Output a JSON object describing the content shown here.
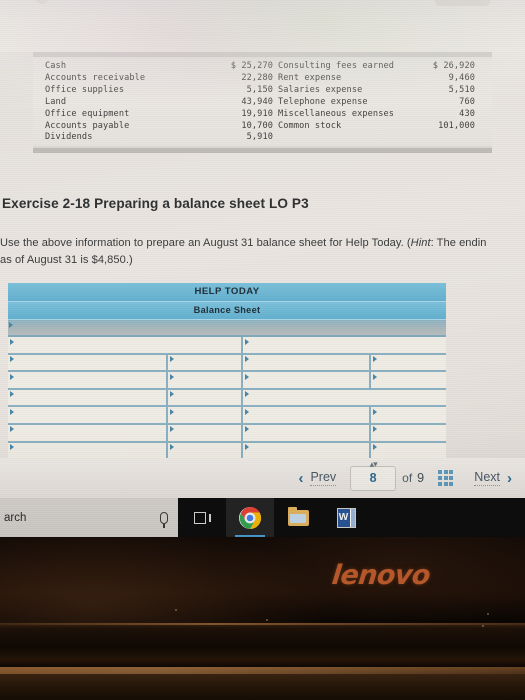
{
  "screen": {
    "account_data": {
      "rows": [
        {
          "name1": "Cash",
          "amt1": "$ 25,270",
          "name2": "Consulting fees earned",
          "amt2": "$ 26,920"
        },
        {
          "name1": "Accounts receivable",
          "amt1": "22,280",
          "name2": "Rent expense",
          "amt2": "9,460"
        },
        {
          "name1": "Office supplies",
          "amt1": "5,150",
          "name2": "Salaries expense",
          "amt2": "5,510"
        },
        {
          "name1": "Land",
          "amt1": "43,940",
          "name2": "Telephone expense",
          "amt2": "760"
        },
        {
          "name1": "Office equipment",
          "amt1": "19,910",
          "name2": "Miscellaneous expenses",
          "amt2": "430"
        },
        {
          "name1": "Accounts payable",
          "amt1": "10,700",
          "name2": "Common stock",
          "amt2": "101,000"
        },
        {
          "name1": "Dividends",
          "amt1": "5,910",
          "name2": "",
          "amt2": ""
        }
      ]
    },
    "exercise": {
      "title": "Exercise 2-18 Preparing a balance sheet LO P3",
      "instruction_part1": "Use the above information to prepare an August 31 balance sheet for Help Today. (",
      "instruction_hint_label": "Hint",
      "instruction_part2": ": The endin",
      "instruction_line2": "as of August 31 is $4,850.)"
    },
    "balance_form": {
      "company_name": "HELP TODAY",
      "statement_title": "Balance Sheet"
    },
    "pager": {
      "prev_label": "Prev",
      "current_page": "8",
      "spinner_glyph": "▴▾",
      "of_label": "of",
      "total_pages": "9",
      "grid_icon": "grid-icon",
      "next_label": "Next",
      "prev_chevron": "‹",
      "next_chevron": "›"
    }
  },
  "taskbar": {
    "search_text": "arch",
    "mic_icon": "microphone-icon",
    "task_view_icon": "task-view-icon",
    "chrome_icon": "chrome-icon",
    "explorer_icon": "file-explorer-icon",
    "word_icon": "word-icon",
    "word_letter": "W"
  },
  "laptop": {
    "brand": "lenovo",
    "brand_color": "#b4572a"
  }
}
